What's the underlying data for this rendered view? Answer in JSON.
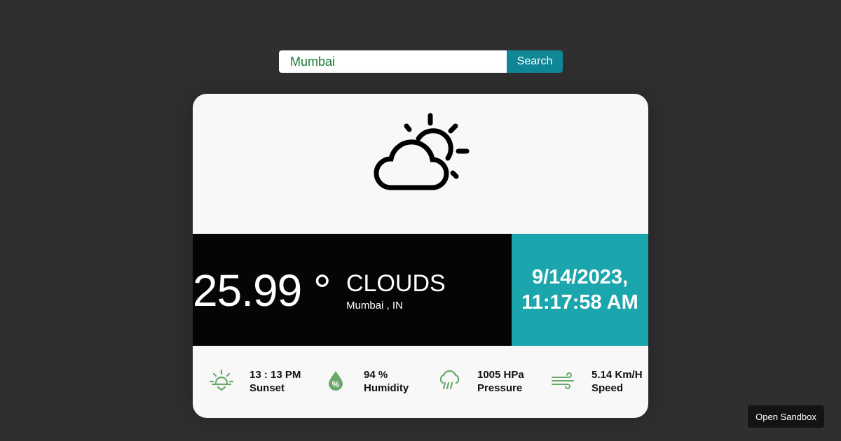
{
  "search": {
    "value": "Mumbai",
    "button_label": "Search"
  },
  "weather": {
    "icon": "partly-cloudy-icon",
    "temperature": "25.99 °",
    "condition": "CLOUDS",
    "location": "Mumbai , IN",
    "date": "9/14/2023,",
    "time": "11:17:58 AM"
  },
  "stats": [
    {
      "icon": "sunset-icon",
      "value": "13 : 13 PM",
      "label": "Sunset"
    },
    {
      "icon": "humidity-icon",
      "value": "94 %",
      "label": "Humidity"
    },
    {
      "icon": "pressure-icon",
      "value": "1005 HPa",
      "label": "Pressure"
    },
    {
      "icon": "wind-icon",
      "value": "5.14 Km/H",
      "label": "Speed"
    }
  ],
  "sandbox": {
    "label": "Open Sandbox"
  },
  "colors": {
    "background": "#2f2f2f",
    "card": "#f8f8f8",
    "search_button": "#0f8797",
    "temp_panel": "#060504",
    "date_panel": "#1ba6ad",
    "stat_icon": "#6aa86a"
  }
}
